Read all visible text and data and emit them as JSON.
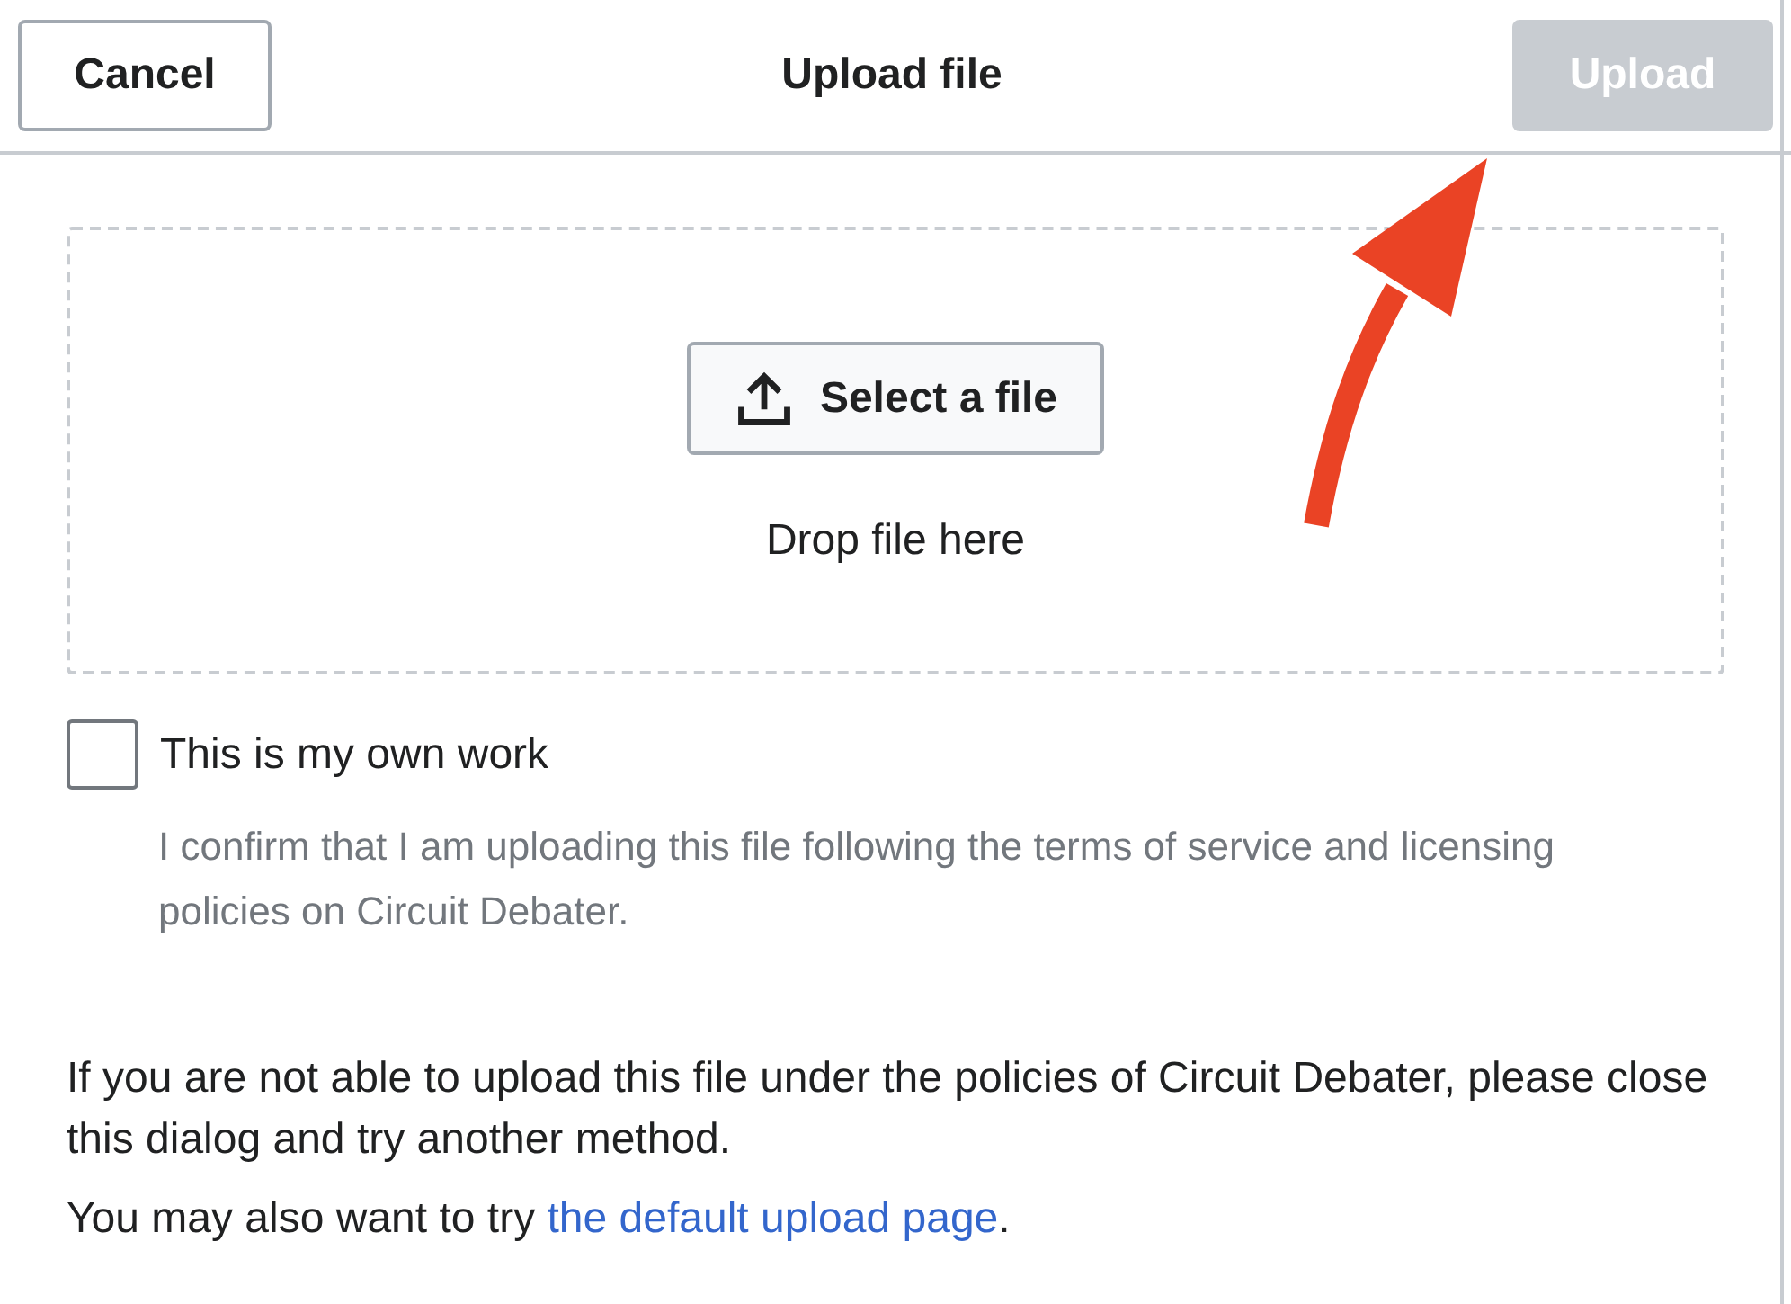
{
  "header": {
    "cancel": "Cancel",
    "title": "Upload file",
    "upload": {
      "label": "Upload",
      "disabled": true
    }
  },
  "dropzone": {
    "button": "Select a file",
    "hint": "Drop file here"
  },
  "own_work": {
    "label": "This is my own work",
    "checked": false,
    "help": "I confirm that I am uploading this file following the terms of service and licensing policies on Circuit Debater."
  },
  "notice": "If you are not able to upload this file under the policies of Circuit Debater, please close this dialog and try another method.",
  "alternative": {
    "before": "You may also want to try ",
    "link": "the default upload page",
    "after": "."
  }
}
